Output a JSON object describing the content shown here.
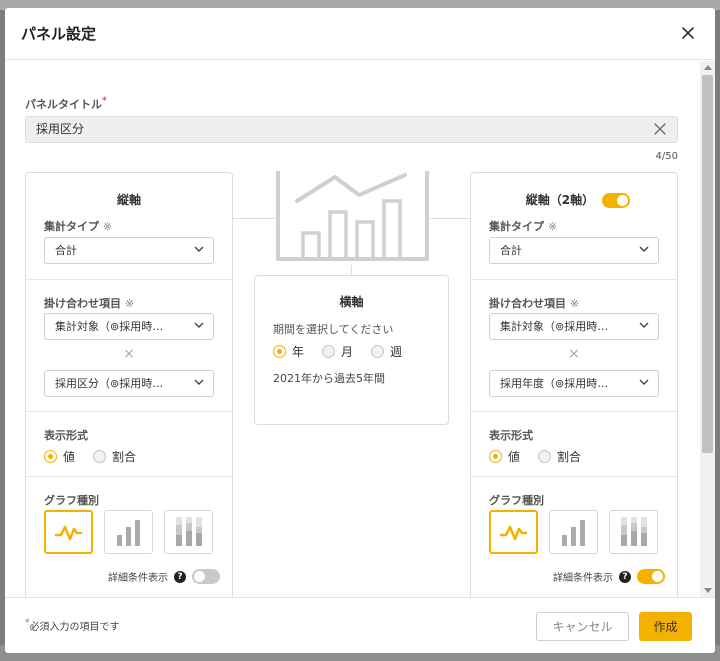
{
  "modal": {
    "title": "パネル設定"
  },
  "panel_title_field": {
    "label": "パネルタイトル",
    "required_mark": "*",
    "value": "採用区分",
    "char_count": "4/50"
  },
  "left_panel": {
    "title": "縦軸",
    "aggregation_type": {
      "label": "集計タイプ",
      "note": "※",
      "value": "合計"
    },
    "combination": {
      "label": "掛け合わせ項目",
      "note": "※",
      "value1": "集計対象（⊚採用時…",
      "times": "×",
      "value2": "採用区分（⊚採用時…"
    },
    "display_format": {
      "label": "表示形式",
      "options": [
        "値",
        "割合"
      ],
      "selected": 0
    },
    "graph_type": {
      "label": "グラフ種別",
      "selected": "line"
    },
    "detail": {
      "label": "詳細条件表示",
      "help": "?",
      "enabled": false
    }
  },
  "right_panel": {
    "title": "縦軸（2軸）",
    "secondary_axis_enabled": true,
    "aggregation_type": {
      "label": "集計タイプ",
      "note": "※",
      "value": "合計"
    },
    "combination": {
      "label": "掛け合わせ項目",
      "note": "※",
      "value1": "集計対象（⊚採用時…",
      "times": "×",
      "value2": "採用年度（⊚採用時…"
    },
    "display_format": {
      "label": "表示形式",
      "options": [
        "値",
        "割合"
      ],
      "selected": 0
    },
    "graph_type": {
      "label": "グラフ種別",
      "selected": "line"
    },
    "detail": {
      "label": "詳細条件表示",
      "help": "?",
      "enabled": true
    }
  },
  "center_panel": {
    "title": "横軸",
    "period_label": "期間を選択してください",
    "options": [
      "年",
      "月",
      "週"
    ],
    "selected": 0,
    "note": "2021年から過去5年間"
  },
  "footer": {
    "required_note_mark": "*",
    "required_note": "必須入力の項目です",
    "cancel_label": "キャンセル",
    "create_label": "作成"
  },
  "colors": {
    "accent": "#f5b100",
    "border": "#dcdcdc",
    "illustration": "#cfcfcf"
  },
  "icons": {
    "close": "close-icon",
    "clear": "clear-icon",
    "chevron": "chevron-down-icon",
    "help": "help-icon"
  }
}
